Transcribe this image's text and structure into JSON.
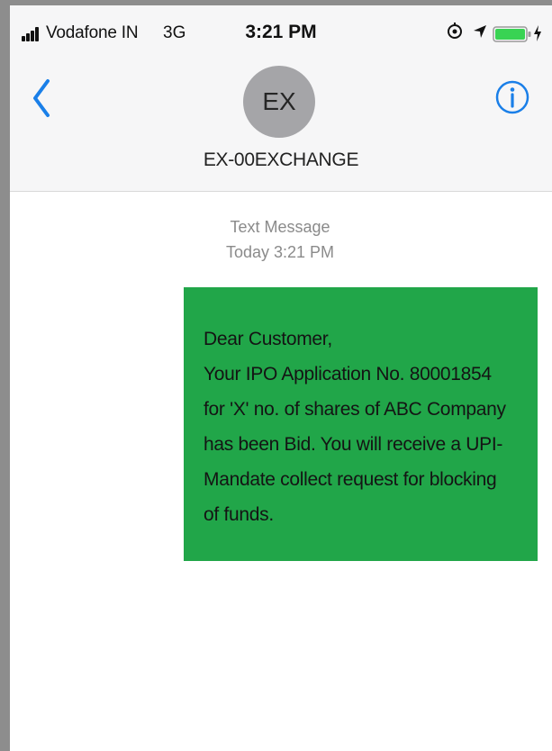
{
  "status_bar": {
    "carrier": "Vodafone IN",
    "network": "3G",
    "time": "3:21 PM"
  },
  "header": {
    "avatar_initials": "EX",
    "contact_name": "EX-00EXCHANGE",
    "back_icon": "chevron-left-icon",
    "info_icon": "info-icon"
  },
  "conversation": {
    "timestamp_label": "Text Message",
    "timestamp_value": "Today 3:21 PM",
    "messages": [
      {
        "text": "Dear Customer,\nYour IPO Application No. 80001854\nfor 'X' no. of shares of ABC Company\nhas been Bid. You will receive a UPI-\nMandate collect request for blocking\nof funds."
      }
    ]
  },
  "colors": {
    "accent": "#1a7fe8",
    "bubble": "#21a649",
    "battery": "#39d353"
  }
}
